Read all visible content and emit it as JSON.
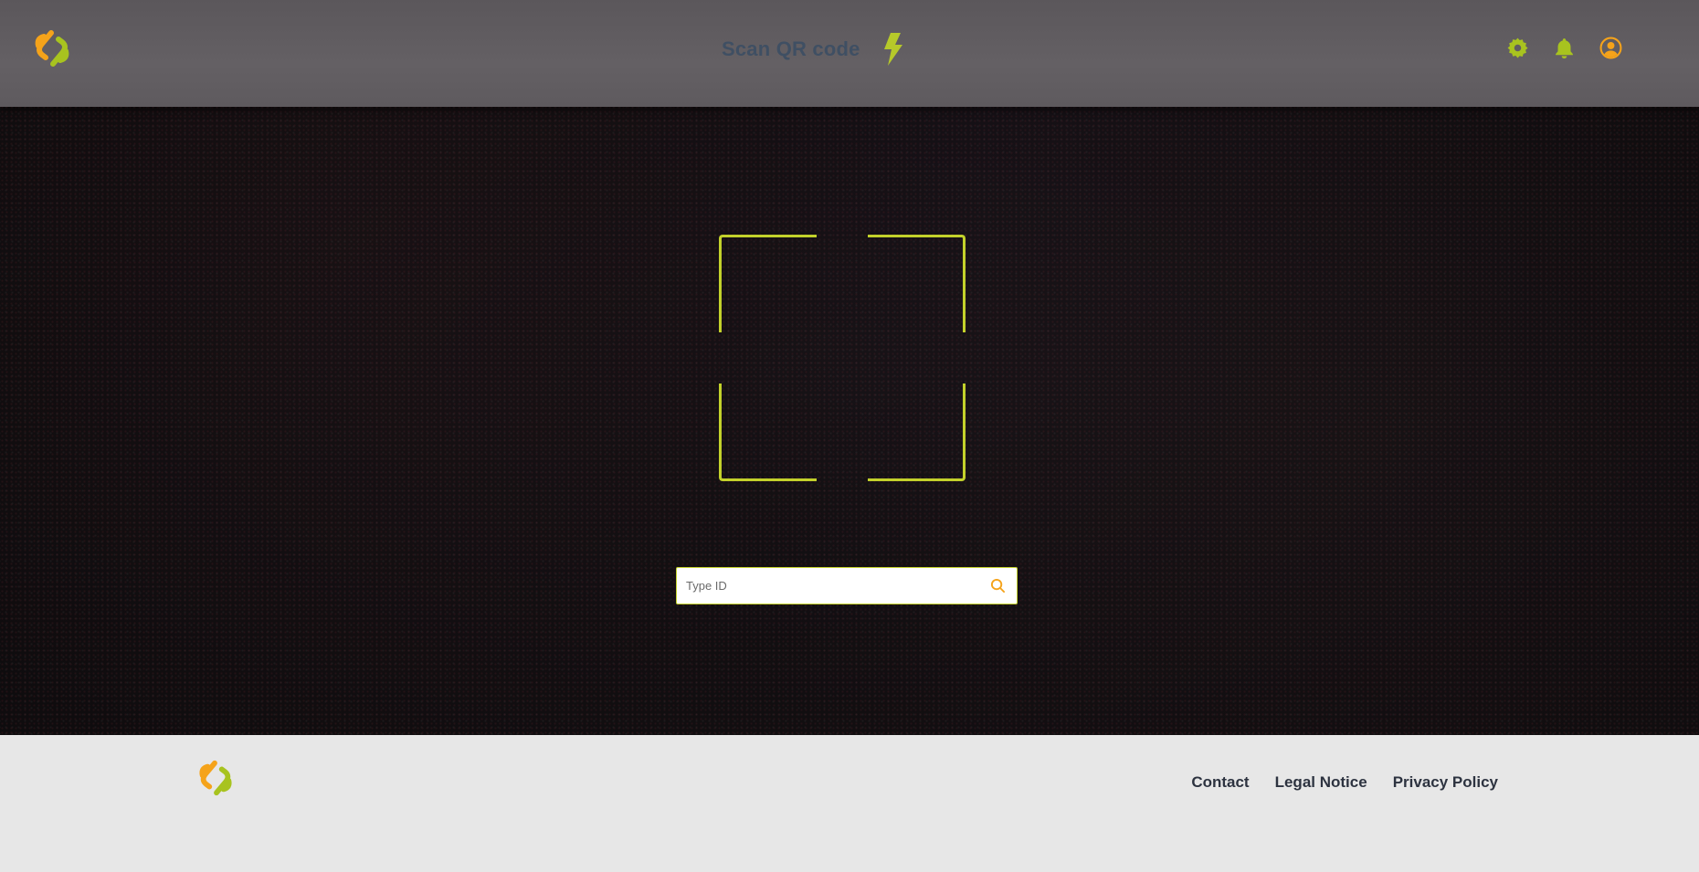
{
  "header": {
    "title": "Scan QR code",
    "logo_icon": "brand-logo",
    "flash_icon": "lightning-bolt-icon",
    "actions": [
      {
        "name": "settings",
        "icon": "gear-icon"
      },
      {
        "name": "notifications",
        "icon": "bell-icon"
      },
      {
        "name": "account",
        "icon": "user-circle-icon"
      }
    ]
  },
  "scanner": {
    "frame_icon": "scan-frame"
  },
  "search": {
    "value": "",
    "placeholder": "Type ID",
    "button_icon": "search-icon"
  },
  "footer": {
    "logo_icon": "brand-logo",
    "links": [
      "Contact",
      "Legal Notice",
      "Privacy Policy"
    ]
  },
  "colors": {
    "accent": "#c3d12b",
    "accent_orange": "#f5a31a",
    "header_bg": "#605c60",
    "title_text": "#3f4f63",
    "footer_bg": "#e7e7e7",
    "footer_text": "#2d3340"
  }
}
